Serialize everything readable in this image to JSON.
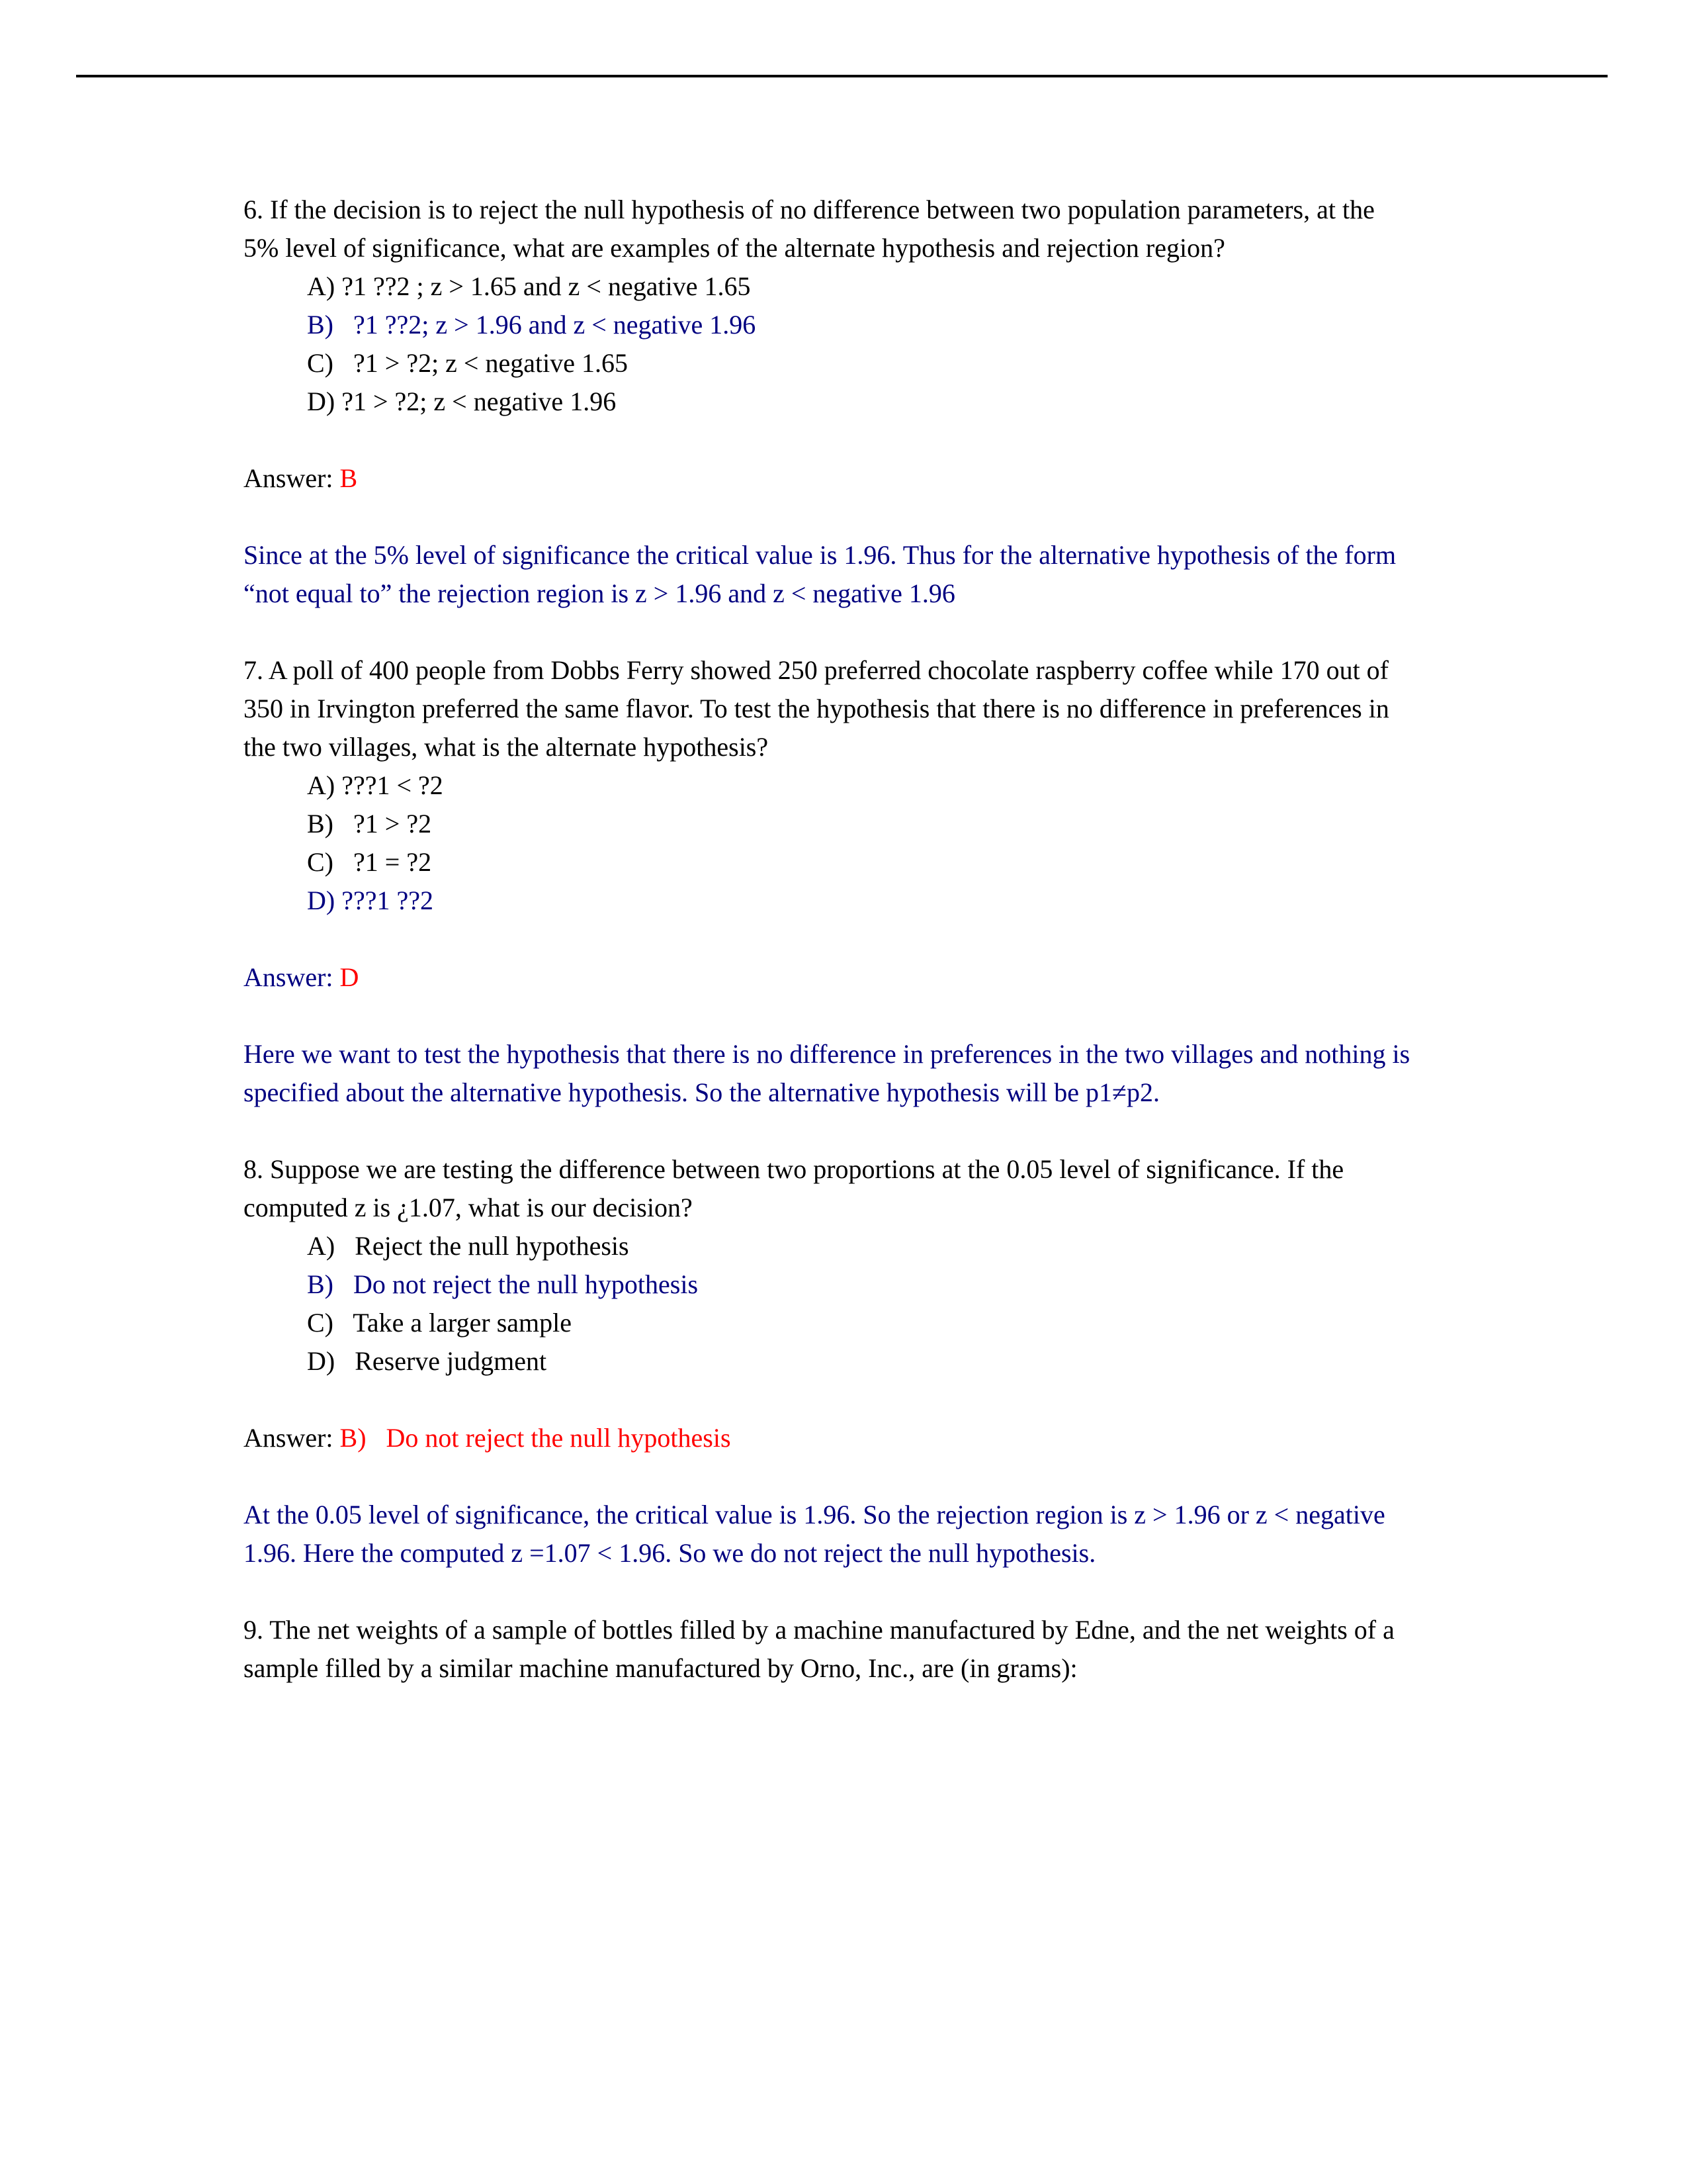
{
  "document": {
    "header_rule": true,
    "colors": {
      "text_black": "#000000",
      "explanation_blue": "#000080",
      "answer_red": "#FF0000",
      "page_background": "#FFFFFF"
    }
  },
  "questions": [
    {
      "number": "6.",
      "stem": "6. If the decision is to reject the null hypothesis of no difference between two population parameters, at the 5% level of significance, what are examples of the alternate hypothesis and rejection region?",
      "choices": [
        {
          "label": "A)",
          "text": "A) ?1 ??2 ; z > 1.65 and z < negative 1.65",
          "color": "black"
        },
        {
          "label": "B)",
          "text": "B)   ?1 ??2; z > 1.96 and z < negative 1.96",
          "color": "blue"
        },
        {
          "label": "C)",
          "text": "C)   ?1 > ?2; z < negative 1.65",
          "color": "black"
        },
        {
          "label": "D)",
          "text": "D) ?1 > ?2; z < negative 1.96",
          "color": "black"
        }
      ],
      "answer_prefix": "Answer: ",
      "answer_prefix_color": "black",
      "answer_value": "B",
      "answer_value_color": "red",
      "explanation": "Since at the 5% level of significance the critical value is 1.96. Thus for the alternative hypothesis of the form “not equal to” the rejection region is z > 1.96 and z < negative 1.96",
      "explanation_color": "blue"
    },
    {
      "number": "7.",
      "stem": "7. A poll of 400 people from Dobbs Ferry showed 250 preferred chocolate raspberry coffee while 170 out of 350 in Irvington preferred the same flavor. To test the hypothesis that there is no difference in preferences in the two villages, what is the alternate hypothesis?",
      "choices": [
        {
          "label": "A)",
          "text": "A) ???1 < ?2",
          "color": "black"
        },
        {
          "label": "B)",
          "text": "B)   ?1 > ?2",
          "color": "black"
        },
        {
          "label": "C)",
          "text": "C)   ?1 = ?2",
          "color": "black"
        },
        {
          "label": "D)",
          "text": "D) ???1 ??2",
          "color": "blue"
        }
      ],
      "answer_prefix": "Answer: ",
      "answer_prefix_color": "blue",
      "answer_value": "D",
      "answer_value_color": "red",
      "explanation": "Here we want to test the hypothesis that there is no difference in preferences in the two villages and nothing is specified about the alternative hypothesis. So the alternative hypothesis will be p1≠p2.",
      "explanation_color": "blue"
    },
    {
      "number": "8.",
      "stem": "8. Suppose we are testing the difference between two proportions at the 0.05 level of significance. If the computed z is ¿1.07, what is our decision?",
      "choices": [
        {
          "label": "A)",
          "text": "A)   Reject the null hypothesis",
          "color": "black"
        },
        {
          "label": "B)",
          "text": "B)   Do not reject the null hypothesis",
          "color": "blue"
        },
        {
          "label": "C)",
          "text": "C)   Take a larger sample",
          "color": "black"
        },
        {
          "label": "D)",
          "text": "D)   Reserve judgment",
          "color": "black"
        }
      ],
      "answer_prefix": "Answer: ",
      "answer_prefix_color": "black",
      "answer_value": "B)   Do not reject the null hypothesis",
      "answer_value_color": "red",
      "explanation": "At the 0.05 level of significance, the critical value is 1.96. So the rejection region is z > 1.96 or z < negative 1.96. Here the computed z =1.07 < 1.96. So we do not reject the null hypothesis.",
      "explanation_color": "blue"
    },
    {
      "number": "9.",
      "stem": "9. The net weights of a sample of bottles filled by a machine manufactured by Edne, and the net weights of a sample filled by a similar machine manufactured by Orno, Inc., are (in grams):",
      "choices": [],
      "answer_prefix": "",
      "answer_prefix_color": "black",
      "answer_value": "",
      "answer_value_color": "red",
      "explanation": "",
      "explanation_color": "blue"
    }
  ]
}
